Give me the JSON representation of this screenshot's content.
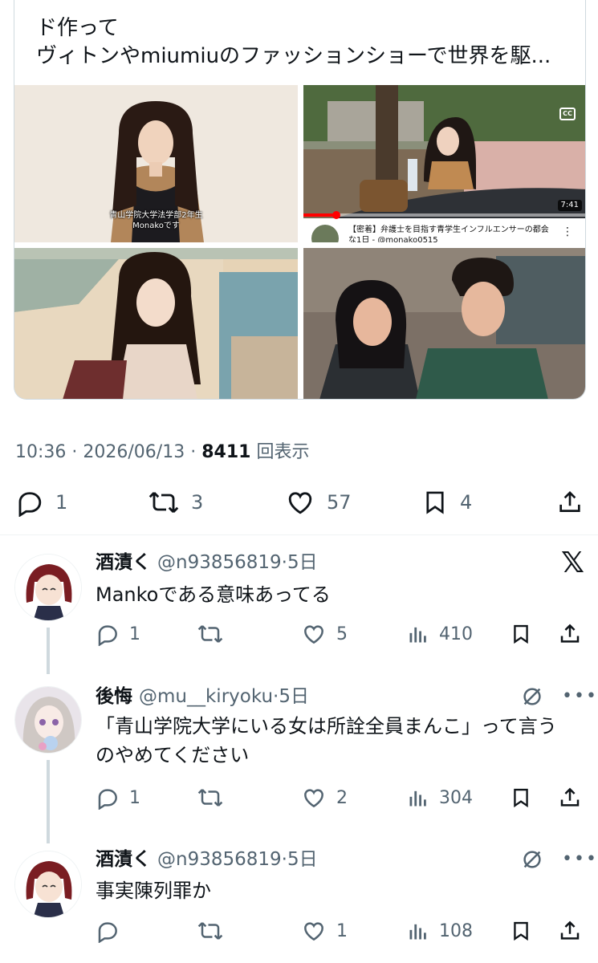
{
  "card": {
    "text_line1": "ド作って",
    "text_line2": "ヴィトンやmiumiuのファッションショーで世界を駆...",
    "image1_caption_line1": "青山学院大学法学部2年生",
    "image1_caption_line2": "Monakoです",
    "video_cc": "CC",
    "video_duration": "7:41",
    "video_title": "【密着】弁護士を目指す青学生インフルエンサーの都会な1日 - @monako0515"
  },
  "tweet": {
    "time": "10:36",
    "date": "2026/06/13",
    "views": "8411",
    "views_label": "回表示",
    "replies": "1",
    "retweets": "3",
    "likes": "57",
    "bookmarks": "4"
  },
  "replies": [
    {
      "name": "酒漬く",
      "handle": "@n93856819",
      "age": "5日",
      "text": "Mankoである意味あってる",
      "reply_count": "1",
      "retweet_count": "",
      "like_count": "5",
      "view_count": "410"
    },
    {
      "name": "後悔",
      "handle": "@mu__kiryoku",
      "age": "5日",
      "text": "「青山学院大学にいる女は所詮全員まんこ」って言うのやめてください",
      "reply_count": "1",
      "retweet_count": "",
      "like_count": "2",
      "view_count": "304"
    },
    {
      "name": "酒漬く",
      "handle": "@n93856819",
      "age": "5日",
      "text": "事実陳列罪か",
      "reply_count": "",
      "retweet_count": "",
      "like_count": "1",
      "view_count": "108"
    }
  ],
  "icons": {
    "reply": "reply-bubble-icon",
    "retweet": "retweet-icon",
    "like": "heart-icon",
    "views": "bar-chart-icon",
    "bookmark": "bookmark-icon",
    "share": "share-icon",
    "grok": "x-logo-icon",
    "not_interested": "slash-circle-icon",
    "more": "more-dots-icon"
  },
  "colors": {
    "text": "#0f1419",
    "secondary": "#536471",
    "border": "#cfd9de",
    "youtube_red": "#ff0000"
  }
}
